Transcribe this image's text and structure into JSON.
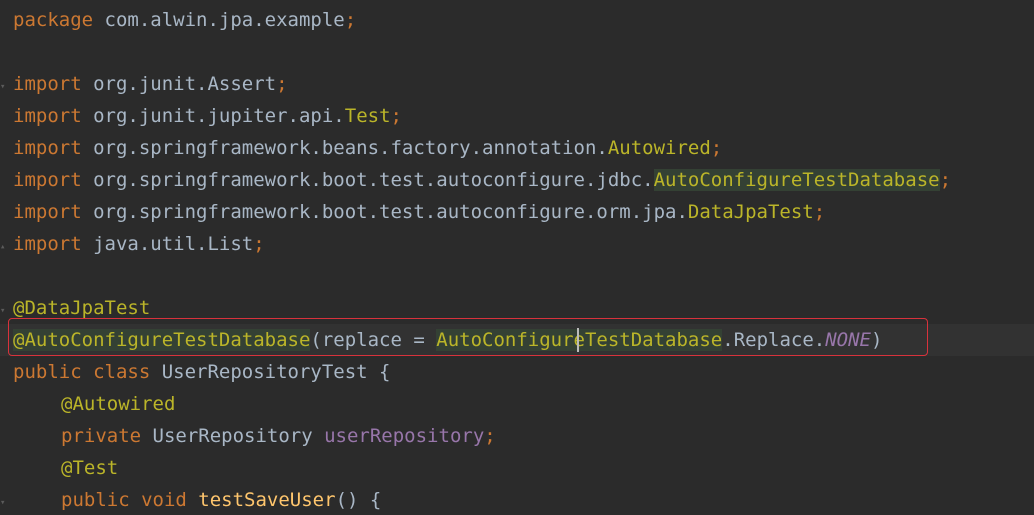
{
  "code": {
    "line1_kw": "package",
    "line1_pkg": " com.alwin.jpa.example",
    "line1_semi": ";",
    "import_kw": "import",
    "i1_pkg": " org.junit.Assert",
    "i2_pkg": " org.junit.jupiter.api.",
    "i2_cls": "Test",
    "i3_pkg": " org.springframework.beans.factory.annotation.",
    "i3_cls": "Autowired",
    "i4_pkg": " org.springframework.boot.test.autoconfigure.jdbc.",
    "i4_cls": "AutoConfigureTestDatabase",
    "i5_pkg": " org.springframework.boot.test.autoconfigure.orm.jpa.",
    "i5_cls": "DataJpaTest",
    "i6_pkg": " java.util.List",
    "semi": ";",
    "ann1": "@DataJpaTest",
    "ann2": "@AutoConfigureTestDatabase",
    "ann2_open": "(replace = ",
    "ann2_cls": "AutoConfigureTestDatabase",
    "ann2_dot": ".Replace.",
    "ann2_const": "NONE",
    "ann2_close": ")",
    "public_kw": "public class",
    "class_name": " UserRepositoryTest {",
    "autowired": "@Autowired",
    "private_kw": "private",
    "field_type": " UserRepository ",
    "field_name": "userRepository",
    "test_ann": "@Test",
    "method_kw": "public void",
    "method_space": " ",
    "method_name": "testSaveUser",
    "method_rest": "() {"
  }
}
